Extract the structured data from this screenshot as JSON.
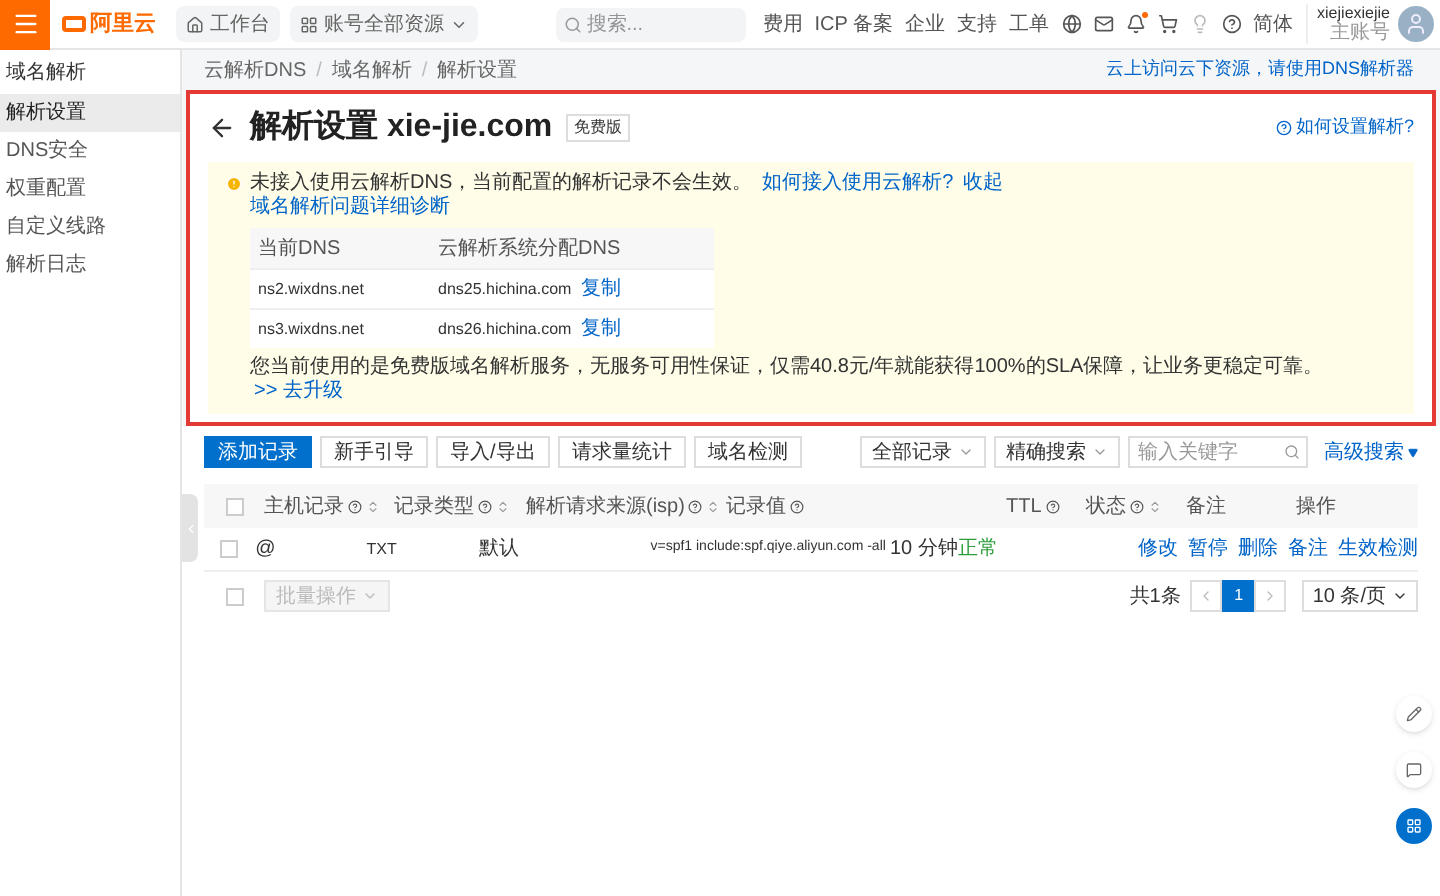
{
  "topbar": {
    "logo": "阿里云",
    "workbench": "工作台",
    "resources": "账号全部资源",
    "search_placeholder": "搜索...",
    "links": [
      "费用",
      "ICP 备案",
      "企业",
      "支持",
      "工单"
    ],
    "language": "简体",
    "user": {
      "name": "xiejiexiejie",
      "role": "主账号"
    }
  },
  "sidebar": {
    "title": "域名解析",
    "items": [
      {
        "label": "解析设置",
        "selected": true
      },
      {
        "label": "DNS安全",
        "selected": false
      },
      {
        "label": "权重配置",
        "selected": false
      },
      {
        "label": "自定义线路",
        "selected": false
      },
      {
        "label": "解析日志",
        "selected": false
      }
    ]
  },
  "breadcrumb": [
    "云解析DNS",
    "域名解析",
    "解析设置"
  ],
  "breadcrumb_separator": "/",
  "top_link": "云上访问云下资源，请使用DNS解析器",
  "header": {
    "title": "解析设置 xie-jie.com",
    "badge": "免费版",
    "help_link": "如何设置解析?"
  },
  "notice": {
    "message": "未接入使用云解析DNS，当前配置的解析记录不会生效。",
    "help_link": "如何接入使用云解析?",
    "collapse_link": "收起",
    "diagnose_link": "域名解析问题详细诊断",
    "dns_table": {
      "columns": [
        "当前DNS",
        "云解析系统分配DNS"
      ],
      "rows": [
        {
          "current": "ns2.wixdns.net",
          "assigned": "dns25.hichina.com",
          "action": "复制"
        },
        {
          "current": "ns3.wixdns.net",
          "assigned": "dns26.hichina.com",
          "action": "复制"
        }
      ]
    },
    "upgrade_text": "您当前使用的是免费版域名解析服务，无服务可用性保证，仅需40.8元/年就能获得100%的SLA保障，让业务更稳定可靠。",
    "upgrade_link": ">> 去升级"
  },
  "toolbar": {
    "buttons": [
      {
        "label": "添加记录",
        "kind": "primary"
      },
      {
        "label": "新手引导",
        "kind": "default"
      },
      {
        "label": "导入/导出",
        "kind": "default"
      },
      {
        "label": "请求量统计",
        "kind": "default"
      },
      {
        "label": "域名检测",
        "kind": "default"
      }
    ],
    "filter": "全部记录",
    "search_mode": "精确搜索",
    "search_placeholder": "输入关键字",
    "advanced": "高级搜索"
  },
  "table": {
    "select_all": {
      "checked": false
    },
    "columns": [
      {
        "label": "主机记录",
        "help": true,
        "sort": true
      },
      {
        "label": "记录类型",
        "help": true,
        "sort": true
      },
      {
        "label": "解析请求来源(isp)",
        "help": true,
        "sort": true
      },
      {
        "label": "记录值",
        "help": true,
        "sort": false
      },
      {
        "label": "TTL",
        "help": true,
        "sort": false
      },
      {
        "label": "状态",
        "help": true,
        "sort": true
      },
      {
        "label": "备注",
        "help": false,
        "sort": false
      },
      {
        "label": "操作",
        "help": false,
        "sort": false
      }
    ],
    "rows": [
      {
        "checked": false,
        "host": "@",
        "type": "TXT",
        "isp": "默认",
        "value": "v=spf1 include:spf.qiye.aliyun.com -all",
        "ttl": "10 分钟",
        "status": "正常",
        "color": "#2e9e3c",
        "actions": [
          "修改",
          "暂停",
          "删除",
          "备注",
          "生效检测"
        ]
      }
    ]
  },
  "footer": {
    "select_all": {
      "checked": false
    },
    "batch": {
      "label": "批量操作",
      "disabled": true
    },
    "total": "共1条",
    "pages": [
      {
        "label": "1",
        "selected": true
      }
    ],
    "page_size": "10 条/页"
  }
}
